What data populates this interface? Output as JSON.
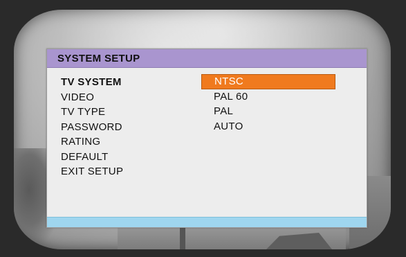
{
  "menu": {
    "title": "SYSTEM SETUP",
    "items": [
      {
        "label": "TV SYSTEM",
        "selected": true
      },
      {
        "label": "VIDEO",
        "selected": false
      },
      {
        "label": "TV TYPE",
        "selected": false
      },
      {
        "label": "PASSWORD",
        "selected": false
      },
      {
        "label": "RATING",
        "selected": false
      },
      {
        "label": "DEFAULT",
        "selected": false
      },
      {
        "label": "EXIT SETUP",
        "selected": false
      }
    ],
    "options": [
      {
        "label": "NTSC",
        "highlighted": true
      },
      {
        "label": "PAL 60",
        "highlighted": false
      },
      {
        "label": "PAL",
        "highlighted": false
      },
      {
        "label": "AUTO",
        "highlighted": false
      }
    ]
  },
  "colors": {
    "title_bar": "#a995cf",
    "highlight": "#f07a1e",
    "footer_bar": "#9fd6ef",
    "panel": "#ededed"
  }
}
